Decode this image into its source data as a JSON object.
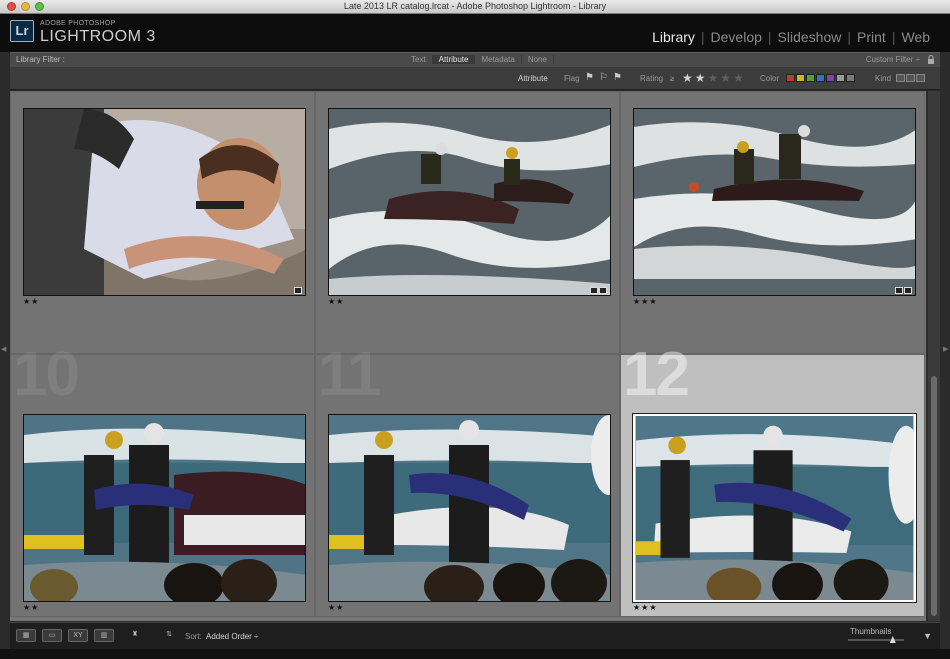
{
  "window": {
    "title": "Late 2013 LR catalog.lrcat - Adobe Photoshop Lightroom - Library"
  },
  "brand": {
    "logo": "Lr",
    "top": "ADOBE PHOTOSHOP",
    "main": "LIGHTROOM 3"
  },
  "modules": [
    "Library",
    "Develop",
    "Slideshow",
    "Print",
    "Web"
  ],
  "active_module": "Library",
  "filter_bar": {
    "label": "Library Filter :",
    "tabs": [
      "Text",
      "Attribute",
      "Metadata",
      "None"
    ],
    "active_tab": "Attribute",
    "custom": "Custom Filter ÷"
  },
  "attribute_bar": {
    "label": "Attribute",
    "flag": "Flag",
    "rating": "Rating",
    "rating_op": "≥",
    "rating_min": 2,
    "color": "Color",
    "kind": "Kind",
    "swatches": [
      "#c0392b",
      "#d4b41e",
      "#4fa334",
      "#3b6fc4",
      "#7c45a8",
      "#9a9a9a",
      "#7a7a7a"
    ]
  },
  "grid": {
    "cells": [
      {
        "num": "",
        "stars": "★★",
        "badge": 1
      },
      {
        "num": "",
        "stars": "★★",
        "badge": 2
      },
      {
        "num": "",
        "stars": "★★★",
        "badge": 2
      },
      {
        "num": "10",
        "stars": "★★",
        "badge": 0
      },
      {
        "num": "11",
        "stars": "★★",
        "badge": 0
      },
      {
        "num": "12",
        "stars": "★★★",
        "badge": 0,
        "selected": true
      }
    ]
  },
  "toolbar": {
    "sort_label": "Sort:",
    "sort_value": "Added Order ÷",
    "thumbnails": "Thumbnails",
    "thumbnail_size": 0.8
  }
}
